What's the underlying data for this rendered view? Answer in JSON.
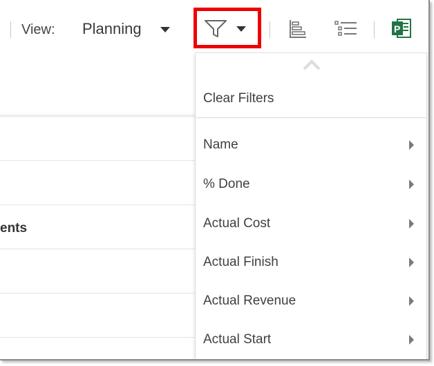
{
  "toolbar": {
    "view_label": "View:",
    "view_value": "Planning",
    "filter_icon": "filter-icon",
    "gantt_icon": "gantt-chart-icon",
    "list_icon": "outline-list-icon",
    "project_icon": "ms-project-icon",
    "highlight_color": "#ee0000",
    "project_color": "#217346"
  },
  "background": {
    "row_fragment": "ents"
  },
  "filter_menu": {
    "scroll_up_icon": "chevron-up-icon",
    "clear_filters": "Clear Filters",
    "items": [
      {
        "label": "Name"
      },
      {
        "label": "% Done"
      },
      {
        "label": "Actual Cost"
      },
      {
        "label": "Actual Finish"
      },
      {
        "label": "Actual Revenue"
      },
      {
        "label": "Actual Start"
      }
    ]
  }
}
